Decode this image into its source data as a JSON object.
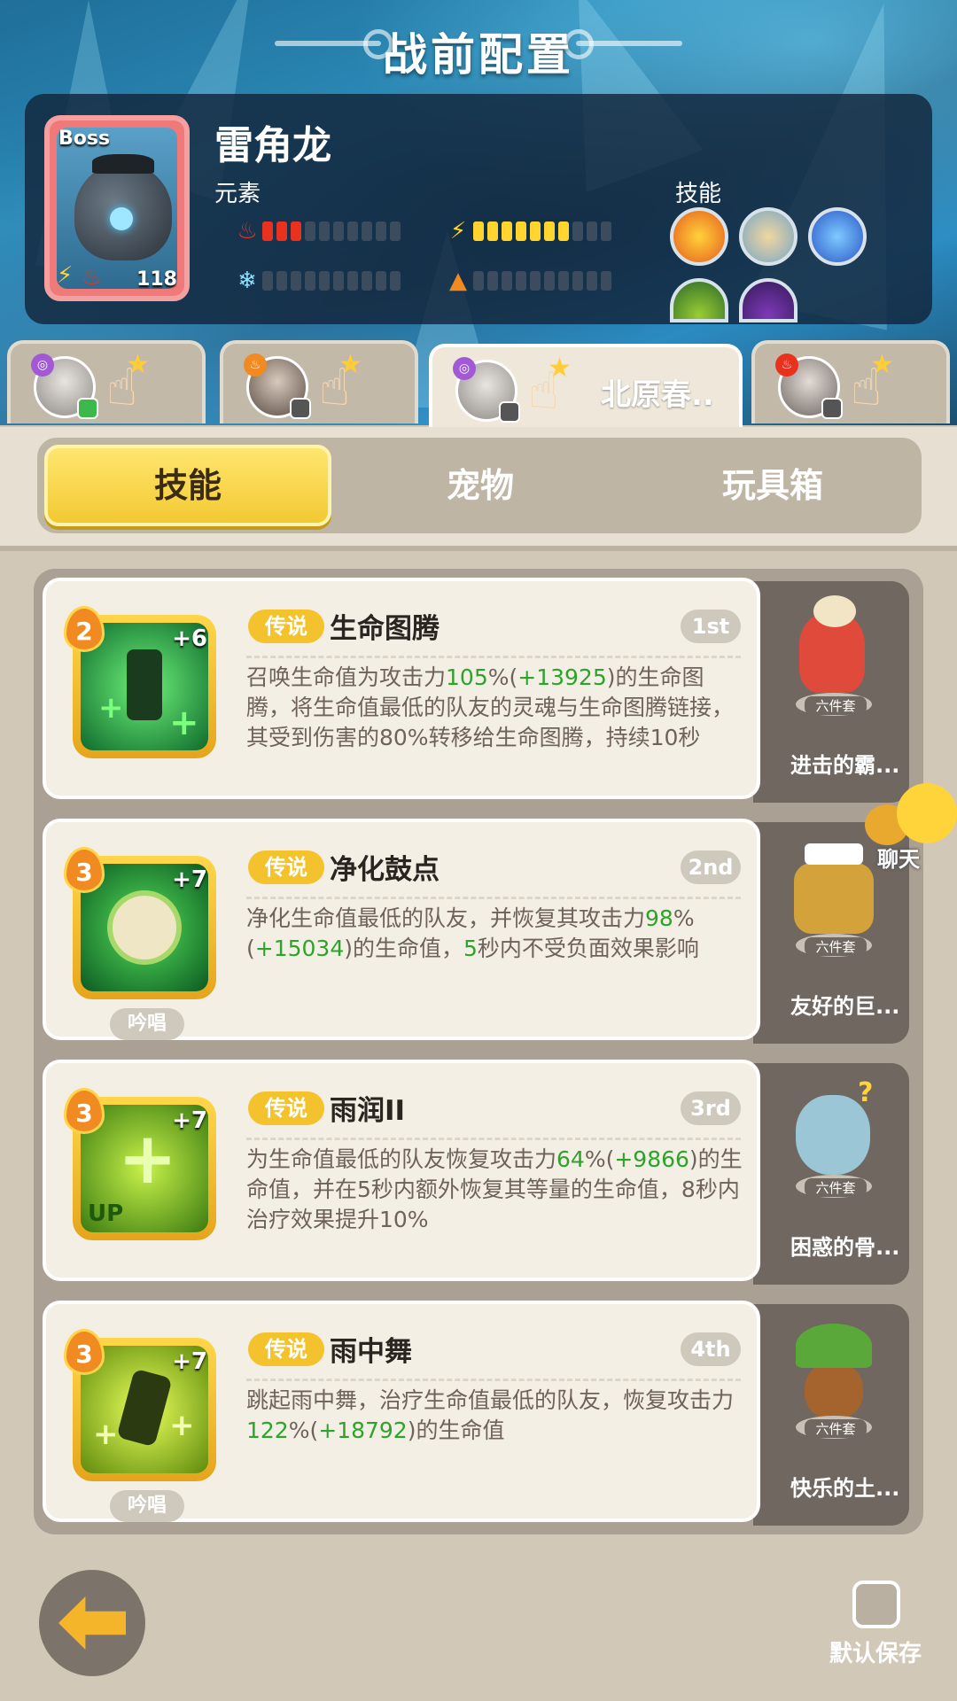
{
  "title": "战前配置",
  "boss": {
    "tag": "Boss",
    "name": "雷角龙",
    "level": "118",
    "element_label": "元素",
    "skill_label": "技能"
  },
  "heroes": [
    {
      "name": ""
    },
    {
      "name": ""
    },
    {
      "name": "北原春.."
    },
    {
      "name": ""
    }
  ],
  "tabs": [
    "技能",
    "宠物",
    "玩具箱"
  ],
  "skills": [
    {
      "rank": "2",
      "plus": "+6",
      "rarity": "传说",
      "name": "生命图腾",
      "order": "1st",
      "chant": "",
      "desc_parts": [
        {
          "t": "召唤生命值为攻击力",
          "c": ""
        },
        {
          "t": "105",
          "c": "g"
        },
        {
          "t": "%(",
          "c": ""
        },
        {
          "t": "+13925",
          "c": "g"
        },
        {
          "t": ")的生命图腾，将生命值最低的队友的灵魂与生命图腾链接，其受到伤害的80%转移给生命图腾，持续10秒",
          "c": ""
        }
      ],
      "pet": "进击的霸..."
    },
    {
      "rank": "3",
      "plus": "+7",
      "rarity": "传说",
      "name": "净化鼓点",
      "order": "2nd",
      "chant": "吟唱",
      "desc_parts": [
        {
          "t": "净化生命值最低的队友，并恢复其攻击力",
          "c": ""
        },
        {
          "t": "98",
          "c": "g"
        },
        {
          "t": "%(",
          "c": ""
        },
        {
          "t": "+15034",
          "c": "g"
        },
        {
          "t": ")的生命值，",
          "c": ""
        },
        {
          "t": "5",
          "c": "g"
        },
        {
          "t": "秒内不受负面效果影响",
          "c": ""
        }
      ],
      "pet": "友好的巨..."
    },
    {
      "rank": "3",
      "plus": "+7",
      "rarity": "传说",
      "name": "雨润II",
      "order": "3rd",
      "chant": "",
      "desc_parts": [
        {
          "t": "为生命值最低的队友恢复攻击力",
          "c": ""
        },
        {
          "t": "64",
          "c": "g"
        },
        {
          "t": "%(",
          "c": ""
        },
        {
          "t": "+9866",
          "c": "g"
        },
        {
          "t": ")的生命值，并在5秒内额外恢复其等量的生命值，8秒内治疗效果提升10%",
          "c": ""
        }
      ],
      "pet": "困惑的骨..."
    },
    {
      "rank": "3",
      "plus": "+7",
      "rarity": "传说",
      "name": "雨中舞",
      "order": "4th",
      "chant": "吟唱",
      "desc_parts": [
        {
          "t": "跳起雨中舞，治疗生命值最低的队友，恢复攻击力",
          "c": ""
        },
        {
          "t": "122",
          "c": "g"
        },
        {
          "t": "%(",
          "c": ""
        },
        {
          "t": "+18792",
          "c": "g"
        },
        {
          "t": ")的生命值",
          "c": ""
        }
      ],
      "pet": "快乐的土..."
    }
  ],
  "pet_set_label": "六件套",
  "chat_label": "聊天",
  "save_label": "默认保存",
  "up_label": "UP",
  "colors": {
    "accent": "#f3c932",
    "legend": "#f3c22d",
    "green": "#2ea32b"
  }
}
